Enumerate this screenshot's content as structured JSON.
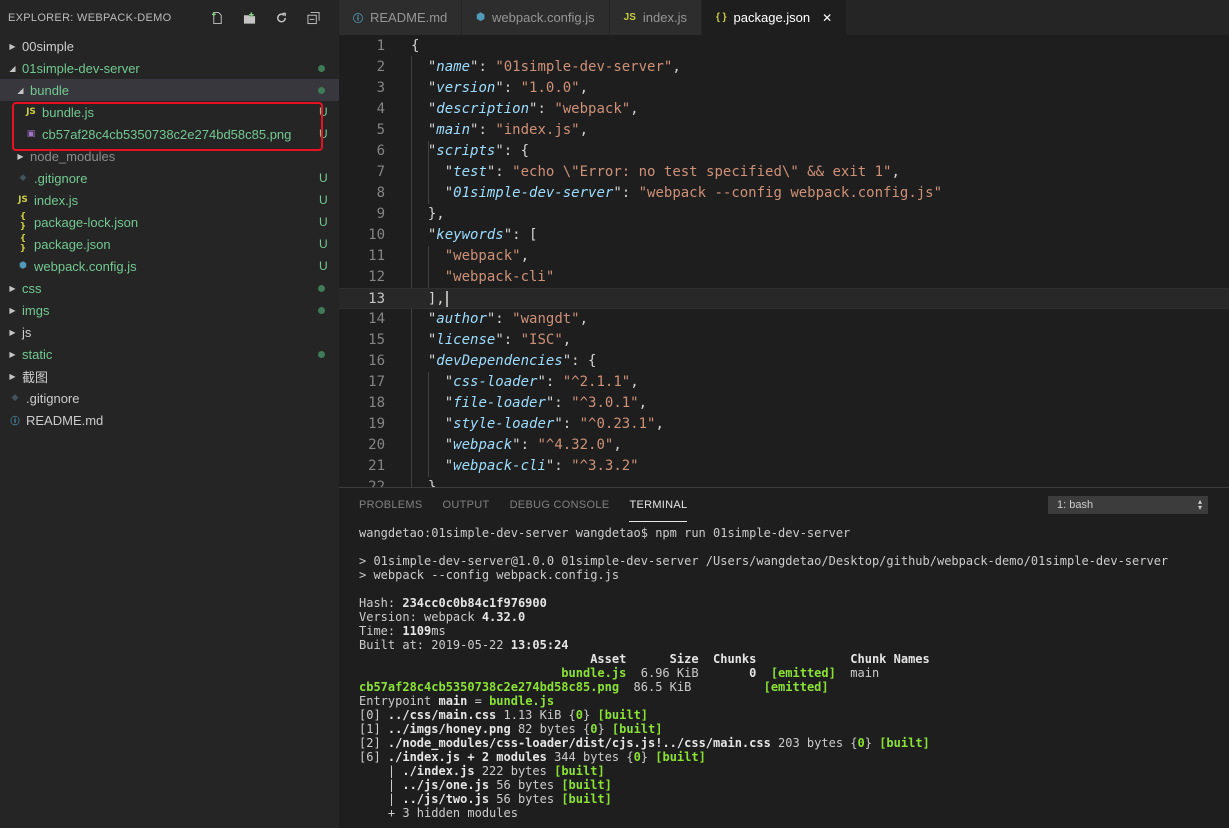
{
  "sidebar": {
    "title": "EXPLORER: WEBPACK-DEMO",
    "header_icons": [
      "new-file-icon",
      "new-folder-icon",
      "refresh-icon",
      "collapse-all-icon"
    ],
    "items": [
      {
        "label": "00simple",
        "type": "folder",
        "open": false,
        "indent": 0,
        "git": "",
        "dot": false,
        "color": "#cccccc"
      },
      {
        "label": "01simple-dev-server",
        "type": "folder",
        "open": true,
        "indent": 0,
        "git": "",
        "dot": true,
        "color": "#73c991"
      },
      {
        "label": "bundle",
        "type": "folder",
        "open": true,
        "indent": 1,
        "git": "",
        "dot": true,
        "color": "#73c991",
        "selected": true
      },
      {
        "label": "bundle.js",
        "type": "js",
        "indent": 2,
        "git": "U",
        "dot": false,
        "color": "#73c991"
      },
      {
        "label": "cb57af28c4cb5350738c2e274bd58c85.png",
        "type": "image",
        "indent": 2,
        "git": "U",
        "dot": false,
        "color": "#73c991"
      },
      {
        "label": "node_modules",
        "type": "folder",
        "open": false,
        "indent": 1,
        "git": "",
        "dot": false,
        "color": "#8c8c8c"
      },
      {
        "label": ".gitignore",
        "type": "git",
        "indent": 1,
        "git": "U",
        "dot": false,
        "color": "#73c991"
      },
      {
        "label": "index.js",
        "type": "js",
        "indent": 1,
        "git": "U",
        "dot": false,
        "color": "#73c991"
      },
      {
        "label": "package-lock.json",
        "type": "json",
        "indent": 1,
        "git": "U",
        "dot": false,
        "color": "#73c991"
      },
      {
        "label": "package.json",
        "type": "json",
        "indent": 1,
        "git": "U",
        "dot": false,
        "color": "#73c991"
      },
      {
        "label": "webpack.config.js",
        "type": "webpack",
        "indent": 1,
        "git": "U",
        "dot": false,
        "color": "#73c991"
      },
      {
        "label": "css",
        "type": "folder",
        "open": false,
        "indent": 0,
        "git": "",
        "dot": true,
        "color": "#73c991"
      },
      {
        "label": "imgs",
        "type": "folder",
        "open": false,
        "indent": 0,
        "git": "",
        "dot": true,
        "color": "#73c991"
      },
      {
        "label": "js",
        "type": "folder",
        "open": false,
        "indent": 0,
        "git": "",
        "dot": false,
        "color": "#cccccc"
      },
      {
        "label": "static",
        "type": "folder",
        "open": false,
        "indent": 0,
        "git": "",
        "dot": true,
        "color": "#73c991"
      },
      {
        "label": "截图",
        "type": "folder",
        "open": false,
        "indent": 0,
        "git": "",
        "dot": false,
        "color": "#cccccc"
      },
      {
        "label": ".gitignore",
        "type": "git",
        "indent": 0,
        "git": "",
        "dot": false,
        "color": "#cccccc"
      },
      {
        "label": "README.md",
        "type": "info",
        "indent": 0,
        "git": "",
        "dot": false,
        "color": "#cccccc"
      }
    ]
  },
  "tabs": [
    {
      "label": "README.md",
      "icon": "info-icon",
      "active": false
    },
    {
      "label": "webpack.config.js",
      "icon": "webpack-icon",
      "active": false
    },
    {
      "label": "index.js",
      "icon": "js-file-icon",
      "active": false
    },
    {
      "label": "package.json",
      "icon": "json-file-icon",
      "active": true,
      "close": "✕"
    }
  ],
  "editor": {
    "current_line": 13,
    "lines": [
      [
        [
          "p",
          "{"
        ]
      ],
      [
        [
          "p",
          "  "
        ],
        [
          "p",
          "\""
        ],
        [
          "k",
          "name"
        ],
        [
          "p",
          "\": "
        ],
        [
          "s",
          "\"01simple-dev-server\""
        ],
        [
          "p",
          ","
        ]
      ],
      [
        [
          "p",
          "  \""
        ],
        [
          "k",
          "version"
        ],
        [
          "p",
          "\": "
        ],
        [
          "s",
          "\"1.0.0\""
        ],
        [
          "p",
          ","
        ]
      ],
      [
        [
          "p",
          "  \""
        ],
        [
          "k",
          "description"
        ],
        [
          "p",
          "\": "
        ],
        [
          "s",
          "\"webpack\""
        ],
        [
          "p",
          ","
        ]
      ],
      [
        [
          "p",
          "  \""
        ],
        [
          "k",
          "main"
        ],
        [
          "p",
          "\": "
        ],
        [
          "s",
          "\"index.js\""
        ],
        [
          "p",
          ","
        ]
      ],
      [
        [
          "p",
          "  \""
        ],
        [
          "k",
          "scripts"
        ],
        [
          "p",
          "\": {"
        ]
      ],
      [
        [
          "p",
          "    \""
        ],
        [
          "k",
          "test"
        ],
        [
          "p",
          "\": "
        ],
        [
          "s",
          "\"echo \\\"Error: no test specified\\\" && exit 1\""
        ],
        [
          "p",
          ","
        ]
      ],
      [
        [
          "p",
          "    \""
        ],
        [
          "k",
          "01simple-dev-server"
        ],
        [
          "p",
          "\": "
        ],
        [
          "s",
          "\"webpack --config webpack.config.js\""
        ]
      ],
      [
        [
          "p",
          "  },"
        ]
      ],
      [
        [
          "p",
          "  \""
        ],
        [
          "k",
          "keywords"
        ],
        [
          "p",
          "\": ["
        ]
      ],
      [
        [
          "p",
          "    "
        ],
        [
          "s",
          "\"webpack\""
        ],
        [
          "p",
          ","
        ]
      ],
      [
        [
          "p",
          "    "
        ],
        [
          "s",
          "\"webpack-cli\""
        ]
      ],
      [
        [
          "p",
          "  ],"
        ]
      ],
      [
        [
          "p",
          "  \""
        ],
        [
          "k",
          "author"
        ],
        [
          "p",
          "\": "
        ],
        [
          "s",
          "\"wangdt\""
        ],
        [
          "p",
          ","
        ]
      ],
      [
        [
          "p",
          "  \""
        ],
        [
          "k",
          "license"
        ],
        [
          "p",
          "\": "
        ],
        [
          "s",
          "\"ISC\""
        ],
        [
          "p",
          ","
        ]
      ],
      [
        [
          "p",
          "  \""
        ],
        [
          "k",
          "devDependencies"
        ],
        [
          "p",
          "\": {"
        ]
      ],
      [
        [
          "p",
          "    \""
        ],
        [
          "k",
          "css-loader"
        ],
        [
          "p",
          "\": "
        ],
        [
          "s",
          "\"^2.1.1\""
        ],
        [
          "p",
          ","
        ]
      ],
      [
        [
          "p",
          "    \""
        ],
        [
          "k",
          "file-loader"
        ],
        [
          "p",
          "\": "
        ],
        [
          "s",
          "\"^3.0.1\""
        ],
        [
          "p",
          ","
        ]
      ],
      [
        [
          "p",
          "    \""
        ],
        [
          "k",
          "style-loader"
        ],
        [
          "p",
          "\": "
        ],
        [
          "s",
          "\"^0.23.1\""
        ],
        [
          "p",
          ","
        ]
      ],
      [
        [
          "p",
          "    \""
        ],
        [
          "k",
          "webpack"
        ],
        [
          "p",
          "\": "
        ],
        [
          "s",
          "\"^4.32.0\""
        ],
        [
          "p",
          ","
        ]
      ],
      [
        [
          "p",
          "    \""
        ],
        [
          "k",
          "webpack-cli"
        ],
        [
          "p",
          "\": "
        ],
        [
          "s",
          "\"^3.3.2\""
        ]
      ],
      [
        [
          "p",
          "  }"
        ]
      ]
    ]
  },
  "panel": {
    "tabs": [
      {
        "label": "PROBLEMS",
        "active": false
      },
      {
        "label": "OUTPUT",
        "active": false
      },
      {
        "label": "DEBUG CONSOLE",
        "active": false
      },
      {
        "label": "TERMINAL",
        "active": true
      }
    ],
    "shell_select": "1: bash",
    "terminal": [
      [
        [
          "n",
          "wangdetao:01simple-dev-server wangdetao$ npm run 01simple-dev-server"
        ]
      ],
      [
        [
          "n",
          ""
        ]
      ],
      [
        [
          "n",
          "> 01simple-dev-server@1.0.0 01simple-dev-server /Users/wangdetao/Desktop/github/webpack-demo/01simple-dev-server"
        ]
      ],
      [
        [
          "n",
          "> webpack --config webpack.config.js"
        ]
      ],
      [
        [
          "n",
          ""
        ]
      ],
      [
        [
          "n",
          "Hash: "
        ],
        [
          "b",
          "234cc0c0b84c1f976900"
        ]
      ],
      [
        [
          "n",
          "Version: webpack "
        ],
        [
          "b",
          "4.32.0"
        ]
      ],
      [
        [
          "n",
          "Time: "
        ],
        [
          "b",
          "1109"
        ],
        [
          "n",
          "ms"
        ]
      ],
      [
        [
          "n",
          "Built at: 2019-05-22 "
        ],
        [
          "b",
          "13:05:24"
        ]
      ],
      [
        [
          "b",
          "                                Asset      Size  Chunks             Chunk Names"
        ]
      ],
      [
        [
          "g",
          "                            bundle.js"
        ],
        [
          "n",
          "  6.96 KiB       "
        ],
        [
          "b",
          "0"
        ],
        [
          "n",
          "  "
        ],
        [
          "g",
          "[emitted]"
        ],
        [
          "n",
          "  main"
        ]
      ],
      [
        [
          "g",
          "cb57af28c4cb5350738c2e274bd58c85.png"
        ],
        [
          "n",
          "  86.5 KiB          "
        ],
        [
          "g",
          "[emitted]"
        ]
      ],
      [
        [
          "n",
          "Entrypoint "
        ],
        [
          "b",
          "main"
        ],
        [
          "n",
          " = "
        ],
        [
          "g",
          "bundle.js"
        ]
      ],
      [
        [
          "n",
          "[0] "
        ],
        [
          "b",
          "../css/main.css"
        ],
        [
          "n",
          " 1.13 KiB {"
        ],
        [
          "g",
          "0"
        ],
        [
          "n",
          "} "
        ],
        [
          "g",
          "[built]"
        ]
      ],
      [
        [
          "n",
          "[1] "
        ],
        [
          "b",
          "../imgs/honey.png"
        ],
        [
          "n",
          " 82 bytes {"
        ],
        [
          "g",
          "0"
        ],
        [
          "n",
          "} "
        ],
        [
          "g",
          "[built]"
        ]
      ],
      [
        [
          "n",
          "[2] "
        ],
        [
          "b",
          "./node_modules/css-loader/dist/cjs.js!../css/main.css"
        ],
        [
          "n",
          " 203 bytes {"
        ],
        [
          "g",
          "0"
        ],
        [
          "n",
          "} "
        ],
        [
          "g",
          "[built]"
        ]
      ],
      [
        [
          "n",
          "[6] "
        ],
        [
          "b",
          "./index.js + 2 modules"
        ],
        [
          "n",
          " 344 bytes {"
        ],
        [
          "g",
          "0"
        ],
        [
          "n",
          "} "
        ],
        [
          "g",
          "[built]"
        ]
      ],
      [
        [
          "n",
          "    | "
        ],
        [
          "b",
          "./index.js"
        ],
        [
          "n",
          " 222 bytes "
        ],
        [
          "g",
          "[built]"
        ]
      ],
      [
        [
          "n",
          "    | "
        ],
        [
          "b",
          "../js/one.js"
        ],
        [
          "n",
          " 56 bytes "
        ],
        [
          "g",
          "[built]"
        ]
      ],
      [
        [
          "n",
          "    | "
        ],
        [
          "b",
          "../js/two.js"
        ],
        [
          "n",
          " 56 bytes "
        ],
        [
          "g",
          "[built]"
        ]
      ],
      [
        [
          "n",
          "    + 3 hidden modules"
        ]
      ]
    ]
  },
  "colors": {
    "git_untracked": "#73c991",
    "js_icon": "#cbcb41",
    "json_icon": "#cbcb41",
    "webpack_icon": "#519aba",
    "image_icon": "#a074c4",
    "highlight_box": "#e81123"
  }
}
